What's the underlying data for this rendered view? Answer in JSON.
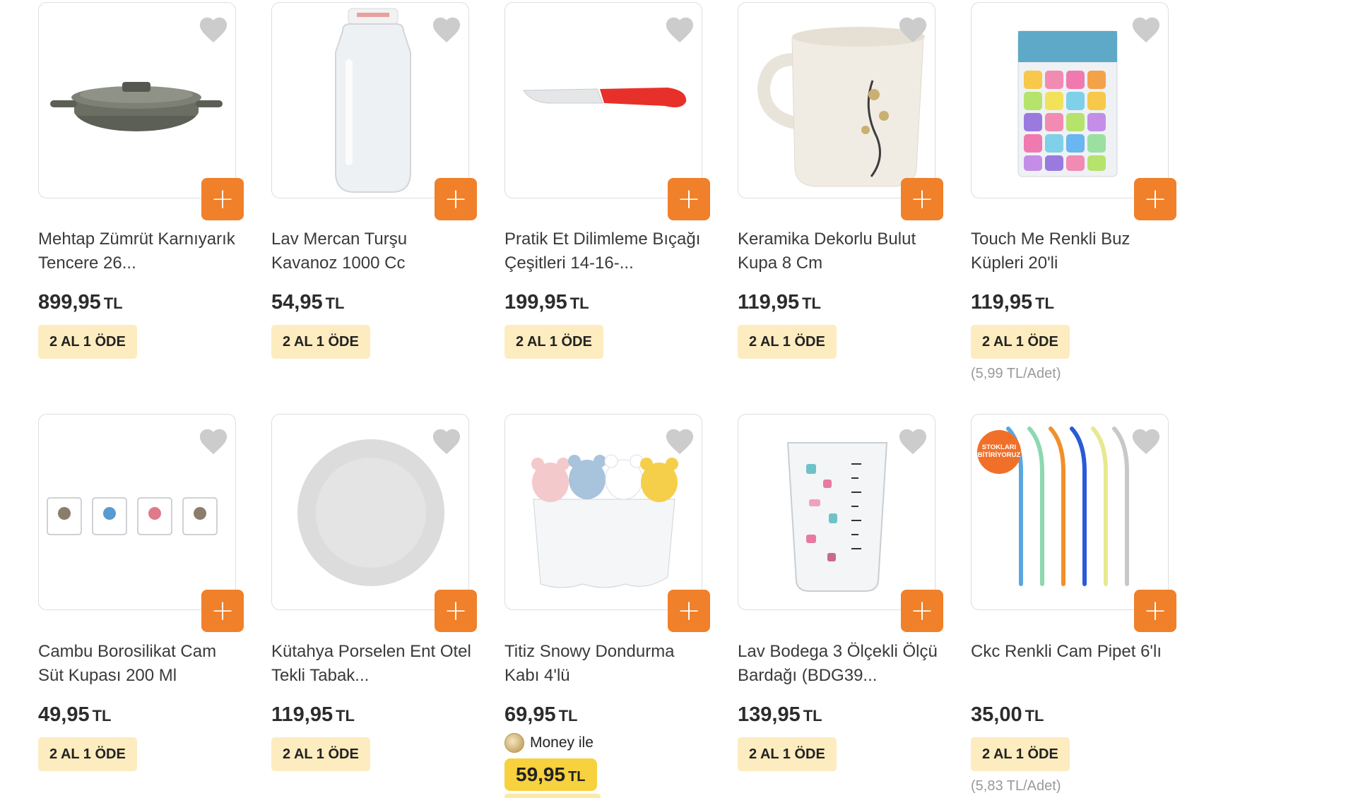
{
  "colors": {
    "accent": "#f0802a",
    "promo_bg": "#fdecbf",
    "money_bg": "#f7d13e",
    "heart": "#cccccc"
  },
  "icons": {
    "favorite": "heart-icon",
    "add": "plus-icon",
    "money": "money-coin-icon"
  },
  "currency": "TL",
  "products": [
    {
      "title": "Mehtap Zümrüt Karnıyarık Tencere 26...",
      "price": "899,95",
      "promo": "2 AL 1 ÖDE",
      "unit_price": ""
    },
    {
      "title": "Lav Mercan Turşu Kavanoz 1000 Cc",
      "price": "54,95",
      "promo": "2 AL 1 ÖDE",
      "unit_price": ""
    },
    {
      "title": "Pratik Et Dilimleme Bıçağı Çeşitleri 14-16-...",
      "price": "199,95",
      "promo": "2 AL 1 ÖDE",
      "unit_price": ""
    },
    {
      "title": "Keramika Dekorlu Bulut Kupa 8 Cm",
      "price": "119,95",
      "promo": "2 AL 1 ÖDE",
      "unit_price": ""
    },
    {
      "title": "Touch Me Renkli Buz Küpleri 20'li",
      "price": "119,95",
      "promo": "2 AL 1 ÖDE",
      "unit_price": "(5,99 TL/Adet)"
    },
    {
      "title": "Cambu Borosilikat Cam Süt Kupası 200 Ml",
      "price": "49,95",
      "promo": "2 AL 1 ÖDE",
      "unit_price": ""
    },
    {
      "title": "Kütahya Porselen Ent Otel Tekli Tabak...",
      "price": "119,95",
      "promo": "2 AL 1 ÖDE",
      "unit_price": ""
    },
    {
      "title": "Titiz Snowy Dondurma Kabı 4'lü",
      "price": "69,95",
      "promo": "",
      "unit_price": "",
      "money_label": "Money ile",
      "money_price": "59,95"
    },
    {
      "title": "Lav Bodega 3 Ölçekli Ölçü Bardağı (BDG39...",
      "price": "139,95",
      "promo": "2 AL 1 ÖDE",
      "unit_price": ""
    },
    {
      "title": "Ckc Renkli Cam Pipet 6'lı",
      "price": "35,00",
      "promo": "2 AL 1 ÖDE",
      "unit_price": "(5,83 TL/Adet)",
      "badge": [
        "STOKLARI",
        "BİTİRİYORUZ"
      ]
    }
  ]
}
